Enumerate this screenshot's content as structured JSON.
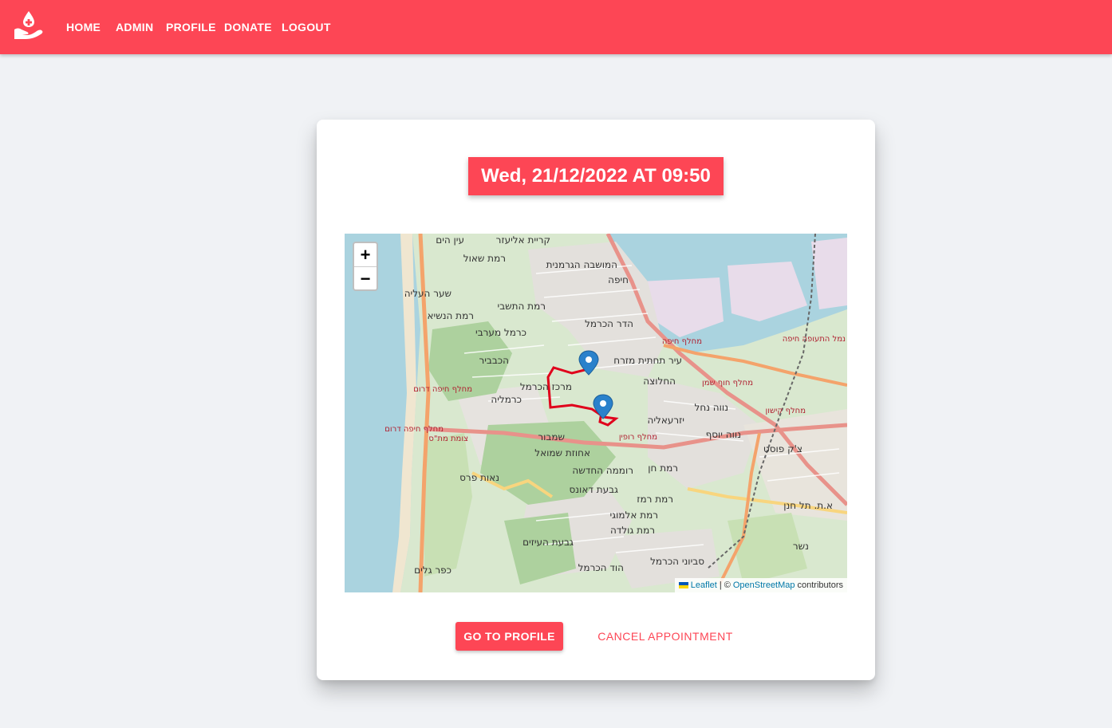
{
  "nav": {
    "logo_icon": "blood-drop-hand-icon",
    "links": [
      "HOME",
      "ADMIN",
      "PROFILE",
      "DONATE",
      "LOGOUT"
    ]
  },
  "appointment": {
    "datetime": "Wed, 21/12/2022 AT 09:50"
  },
  "map": {
    "zoom_in": "+",
    "zoom_out": "−",
    "attribution": {
      "leaflet": "Leaflet",
      "separator": "| ©",
      "osm": "OpenStreetMap",
      "contributors": "contributors"
    },
    "place_labels": [
      "עין הים",
      "קריית אליעזר",
      "רמת שאול",
      "המושבה הגרמנית",
      "חיפה",
      "שער העליה",
      "רמת התשבי",
      "רמת הנשיא",
      "הדר הכרמל",
      "כרמל מערבי",
      "הכבביר",
      "עיר תחתית מזרח",
      "מרכז הכרמל",
      "החלוצה",
      "כרמליה",
      "נווה נחל",
      "יזרעאליה",
      "שמבור",
      "נווה יוסף",
      "אחוזת שמואל",
      "רוממה החדשה",
      "רמת חן",
      "נאות פרס",
      "גבעת דאונס",
      "רמת רמז",
      "רמת אלמוגי",
      "רמת גולדה",
      "גבעת העיזים",
      "סביוני הכרמל",
      "הוד הכרמל",
      "כפר גלים",
      "צ'ק פוסט",
      "א.ת. תל חנן",
      "נשר"
    ],
    "road_labels": [
      "מחלף חיפה דרום",
      "מחלף חיפה דרום",
      "צומת מת\"ס",
      "מחלף רופין",
      "מחלף חוף שמן",
      "מחלף קישון",
      "מחלף חיפה",
      "נמל התעופה חיפה"
    ]
  },
  "actions": {
    "go_to_profile": "GO TO PROFILE",
    "cancel": "CANCEL APPOINTMENT"
  },
  "colors": {
    "brand": "#fd4655",
    "background": "#f0f2f5",
    "route": "#e0001b",
    "marker": "#2a81cb"
  }
}
